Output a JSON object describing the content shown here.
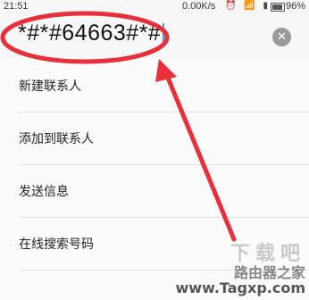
{
  "status_bar": {
    "time": "21:51",
    "network_speed": "0.00K/s",
    "battery": "96%"
  },
  "dialer": {
    "input_value": "*#*#64663#*#",
    "clear_icon": "clear-icon"
  },
  "menu": {
    "items": [
      {
        "label": "新建联系人"
      },
      {
        "label": "添加到联系人"
      },
      {
        "label": "发送信息"
      },
      {
        "label": "在线搜索号码"
      }
    ]
  },
  "annotation": {
    "color": "#e8303a"
  },
  "watermark": {
    "line1": "下载吧",
    "line2": "路由器之家",
    "site": "www.Tagxp.com"
  }
}
